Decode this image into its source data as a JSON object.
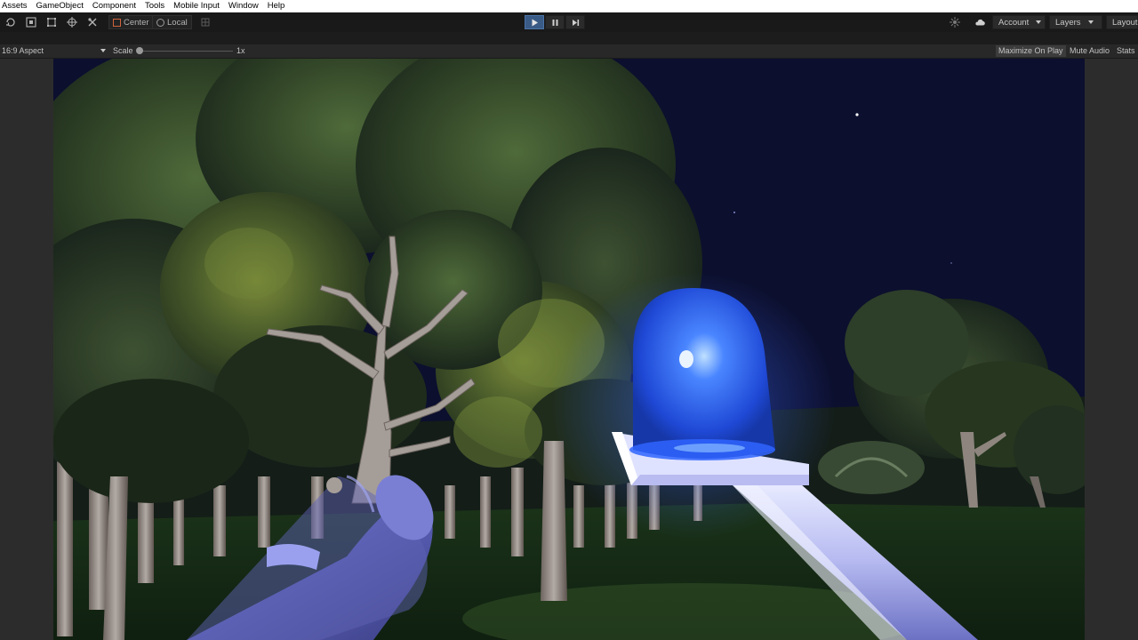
{
  "menu": [
    "Assets",
    "GameObject",
    "Component",
    "Tools",
    "Mobile Input",
    "Window",
    "Help"
  ],
  "toolbar": {
    "tools": [
      "rotate-tool-icon",
      "scale-tool-icon",
      "rect-tool-icon",
      "transform-tool-icon",
      "custom-tool-icon"
    ],
    "pivot_mode": "Center",
    "pivot_rotation": "Local",
    "play_state": "playing",
    "account_label": "Account",
    "layers_label": "Layers",
    "layout_label": "Layout"
  },
  "game_view": {
    "aspect": "16:9 Aspect",
    "scale_label": "Scale",
    "scale_value": "1x",
    "maximize_on_play": "Maximize On Play",
    "mute_audio": "Mute Audio",
    "stats": "Stats"
  },
  "colors": {
    "sky": "#0c0f2e",
    "beacon": "#3f7cff",
    "held_object": "#6f74c9"
  }
}
